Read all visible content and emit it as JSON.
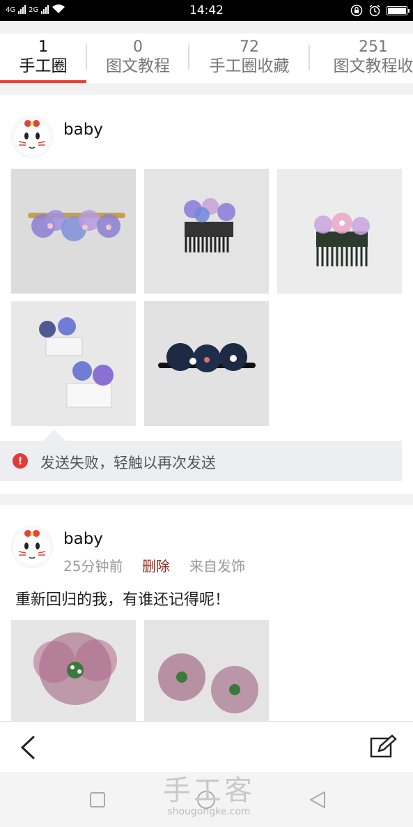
{
  "status_bar": {
    "time": "14:42",
    "network_left": "4G",
    "network_right": "2G"
  },
  "tabs": [
    {
      "count": "1",
      "label": "手工圈",
      "active": true
    },
    {
      "count": "0",
      "label": "图文教程",
      "active": false
    },
    {
      "count": "72",
      "label": "手工圈收藏",
      "active": false
    },
    {
      "count": "251",
      "label": "图文教程收",
      "active": false
    }
  ],
  "post1": {
    "username": "baby",
    "images": [
      "hair clip with purple organza flowers",
      "comb with purple ribbon flowers",
      "comb with pink-purple flowers",
      "two clear combs with blue flowers",
      "navy ribbon flower barrette with pearls"
    ],
    "error_message": "发送失败，轻触以再次发送"
  },
  "post2": {
    "username": "baby",
    "time": "25分钟前",
    "delete_label": "删除",
    "source": "来自发饰",
    "text": "重新回归的我，有谁还记得呢！",
    "images": [
      "mauve organza ribbon flower",
      "two mauve organza ribbon flowers"
    ]
  },
  "toolbar": {
    "back_icon": "chevron-left-icon",
    "compose_icon": "edit-icon"
  },
  "watermark": {
    "title": "手工客",
    "url": "shougongke.com"
  },
  "colors": {
    "accent": "#e0443b",
    "error": "#e53935",
    "delete": "#8b2b22"
  }
}
